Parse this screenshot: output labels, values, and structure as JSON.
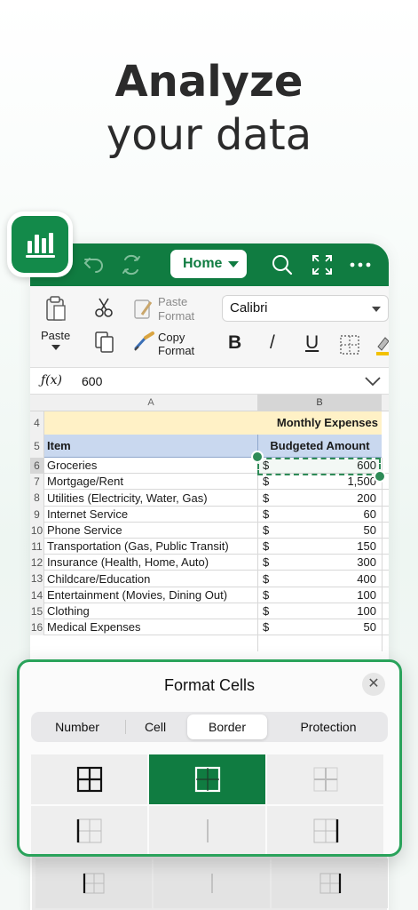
{
  "headline": {
    "line1": "Analyze",
    "line2": "your data"
  },
  "app": {
    "home_tab": "Home",
    "font_name": "Calibri"
  },
  "ribbon": {
    "paste_label": "Paste",
    "paste_format_line1": "Paste",
    "paste_format_line2": "Format",
    "copy_format_line1": "Copy",
    "copy_format_line2": "Format",
    "bold": "B",
    "italic": "/",
    "underline": "U"
  },
  "formula_bar": {
    "fx_label": "ƒ(x)",
    "value": "600"
  },
  "sheet": {
    "columns": [
      "A",
      "B"
    ],
    "rows": [
      {
        "num": "4",
        "item": "",
        "dollar": "",
        "amount": "",
        "title": "Monthly Expenses"
      },
      {
        "num": "5",
        "item": "Item",
        "dollar": "",
        "amount": "",
        "title": "Budgeted Amount"
      },
      {
        "num": "6",
        "item": "Groceries",
        "dollar": "$",
        "amount": "600"
      },
      {
        "num": "7",
        "item": "Mortgage/Rent",
        "dollar": "$",
        "amount": "1,500"
      },
      {
        "num": "8",
        "item": "Utilities (Electricity, Water, Gas)",
        "dollar": "$",
        "amount": "200"
      },
      {
        "num": "9",
        "item": "Internet Service",
        "dollar": "$",
        "amount": "60"
      },
      {
        "num": "10",
        "item": "Phone Service",
        "dollar": "$",
        "amount": "50"
      },
      {
        "num": "11",
        "item": "Transportation (Gas, Public Transit)",
        "dollar": "$",
        "amount": "150"
      },
      {
        "num": "12",
        "item": "Insurance (Health, Home, Auto)",
        "dollar": "$",
        "amount": "300"
      },
      {
        "num": "13",
        "item": "Childcare/Education",
        "dollar": "$",
        "amount": "400"
      },
      {
        "num": "14",
        "item": "Entertainment (Movies, Dining Out)",
        "dollar": "$",
        "amount": "100"
      },
      {
        "num": "15",
        "item": "Clothing",
        "dollar": "$",
        "amount": "100"
      },
      {
        "num": "16",
        "item": "Medical Expenses",
        "dollar": "$",
        "amount": "50"
      }
    ]
  },
  "format_cells": {
    "title": "Format Cells",
    "close": "✕",
    "tabs": [
      "Number",
      "Cell",
      "Border",
      "Protection"
    ],
    "active_tab": "Border",
    "accent": "#107c41"
  }
}
